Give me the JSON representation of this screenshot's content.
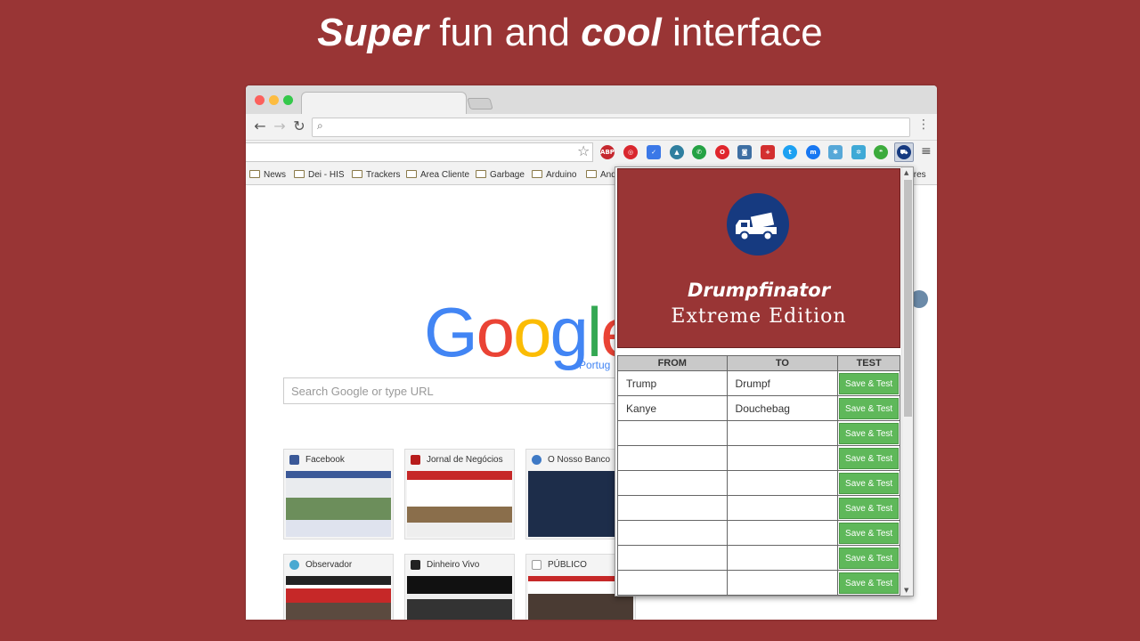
{
  "headline": {
    "bold1": "Super",
    "mid": " fun and ",
    "bold2": "cool",
    "end": " interface"
  },
  "browser": {
    "bookmarks": [
      "News",
      "Dei - HIS",
      "Trackers",
      "Area Cliente",
      "Garbage",
      "Arduino",
      "And",
      "lores"
    ],
    "google_sub": "Portug",
    "search_placeholder": "Search Google or type URL",
    "tiles": [
      {
        "label": "Facebook"
      },
      {
        "label": "Jornal de Negócios"
      },
      {
        "label": "O Nosso Banco"
      },
      {
        "label": "Observador"
      },
      {
        "label": "Dinheiro Vivo"
      },
      {
        "label": "PÚBLICO"
      }
    ]
  },
  "extension": {
    "title": "Drumpfinator",
    "subtitle": "Extreme Edition",
    "columns": {
      "from": "FROM",
      "to": "TO",
      "test": "TEST"
    },
    "button_label": "Save & Test",
    "rows": [
      {
        "from": "Trump",
        "to": "Drumpf"
      },
      {
        "from": "Kanye",
        "to": "Douchebag"
      },
      {
        "from": "",
        "to": ""
      },
      {
        "from": "",
        "to": ""
      },
      {
        "from": "",
        "to": ""
      },
      {
        "from": "",
        "to": ""
      },
      {
        "from": "",
        "to": ""
      },
      {
        "from": "",
        "to": ""
      },
      {
        "from": "",
        "to": ""
      }
    ]
  },
  "colors": {
    "background": "#993535",
    "button": "#5fb85a",
    "logo_circle": "#163a80"
  }
}
